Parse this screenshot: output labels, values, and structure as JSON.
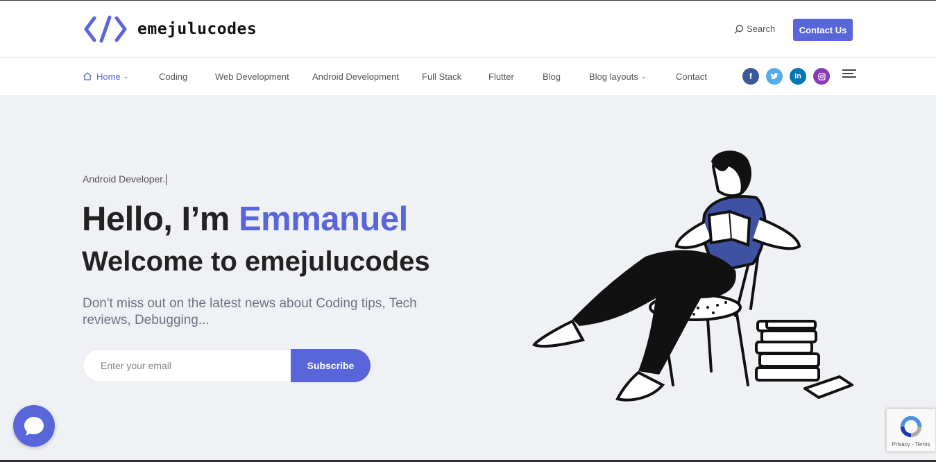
{
  "header": {
    "logo_text": "emejulucodes",
    "search_label": "Search",
    "contact_label": "Contact Us"
  },
  "nav": {
    "items": [
      {
        "label": "Home",
        "dropdown": true,
        "active": true
      },
      {
        "label": "Coding"
      },
      {
        "label": "Web Development"
      },
      {
        "label": "Android Development"
      },
      {
        "label": "Full Stack"
      },
      {
        "label": "Flutter"
      },
      {
        "label": "Blog"
      },
      {
        "label": "Blog layouts",
        "dropdown": true
      },
      {
        "label": "Contact"
      }
    ],
    "social": [
      {
        "icon": "facebook-icon",
        "glyph": "f",
        "color": "#3b5998"
      },
      {
        "icon": "twitter-icon",
        "glyph": "t",
        "color": "#55acee"
      },
      {
        "icon": "linkedin-icon",
        "glyph": "in",
        "color": "#0077b5"
      },
      {
        "icon": "instagram-icon",
        "glyph": "◘",
        "color": "#8a3ab9"
      }
    ]
  },
  "hero": {
    "eyebrow": "Android Developer.",
    "hello": "Hello, I’m",
    "name": "Emmanuel",
    "welcome": "Welcome to emejulucodes",
    "lead": "Don't miss out on the latest news about Coding tips, Tech reviews, Debugging...",
    "email_placeholder": "Enter your email",
    "subscribe_label": "Subscribe"
  },
  "recaptcha": {
    "terms": "Privacy - Terms"
  },
  "colors": {
    "accent": "#5866d9",
    "background": "#f0f1f4"
  }
}
